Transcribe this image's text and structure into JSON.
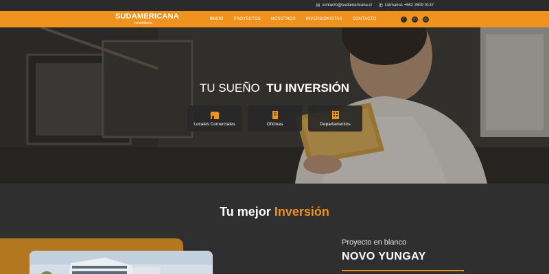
{
  "topbar": {
    "email": "contacto@sudamericana.cl",
    "phone": "Llámanos +562 2609 0137"
  },
  "nav": {
    "logo_text": "SUDAMERICANA",
    "logo_sub": "Inmobiliaria",
    "items": [
      {
        "label": "INICIO",
        "active": true
      },
      {
        "label": "PROYECTOS"
      },
      {
        "label": "NOSOTROS"
      },
      {
        "label": "INVERSIONISTAS"
      },
      {
        "label": "CONTACTO"
      }
    ],
    "social": [
      "facebook-icon",
      "whatsapp-icon",
      "instagram-icon"
    ]
  },
  "hero": {
    "title_light": "TU SUEÑO",
    "title_bold": "TU INVERSIÓN",
    "categories": [
      {
        "label": "Locales Comerciales",
        "icon": "store-icon"
      },
      {
        "label": "Oficinas",
        "icon": "office-building-icon"
      },
      {
        "label": "Departamentos",
        "icon": "apartment-building-icon"
      }
    ]
  },
  "section": {
    "title_white": "Tu mejor",
    "title_orange": "Inversión",
    "project_kicker": "Proyecto en blanco",
    "project_name": "NOVO YUNGAY"
  },
  "colors": {
    "accent": "#f0931e",
    "dark": "#2f2f2f",
    "topbar": "#2b2b2b"
  }
}
